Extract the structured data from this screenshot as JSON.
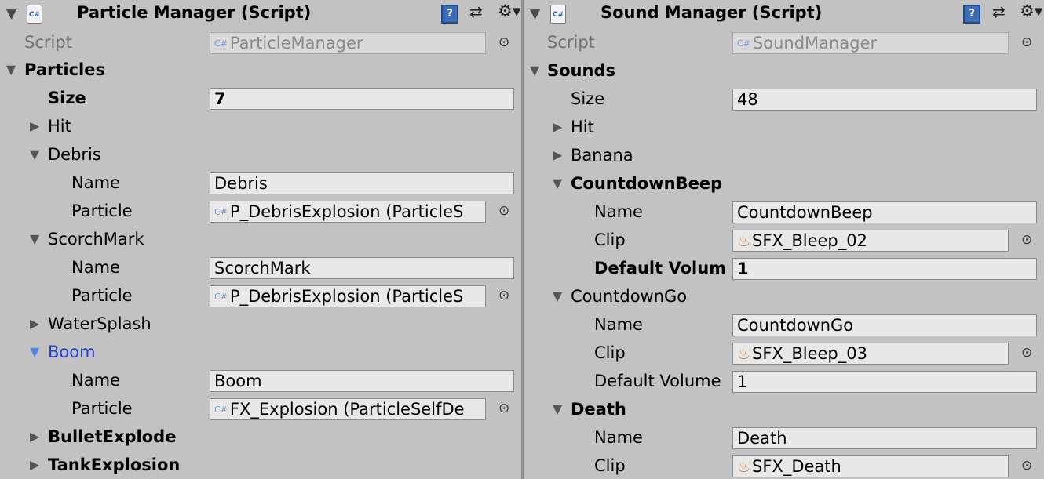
{
  "left": {
    "title": "Particle Manager (Script)",
    "script_label": "Script",
    "script_value": "ParticleManager",
    "list_label": "Particles",
    "size_label": "Size",
    "size_value": "7",
    "items": {
      "hit": "Hit",
      "debris": {
        "label": "Debris",
        "name_label": "Name",
        "name_value": "Debris",
        "particle_label": "Particle",
        "particle_value": "P_DebrisExplosion (ParticleS"
      },
      "scorch": {
        "label": "ScorchMark",
        "name_label": "Name",
        "name_value": "ScorchMark",
        "particle_label": "Particle",
        "particle_value": "P_DebrisExplosion (ParticleS"
      },
      "water": "WaterSplash",
      "boom": {
        "label": "Boom",
        "name_label": "Name",
        "name_value": "Boom",
        "particle_label": "Particle",
        "particle_value": "FX_Explosion (ParticleSelfDe"
      },
      "bullet": "BulletExplode",
      "tank": "TankExplosion"
    }
  },
  "right": {
    "title": "Sound Manager (Script)",
    "script_label": "Script",
    "script_value": "SoundManager",
    "list_label": "Sounds",
    "size_label": "Size",
    "size_value": "48",
    "items": {
      "hit": "Hit",
      "banana": "Banana",
      "beep": {
        "label": "CountdownBeep",
        "name_label": "Name",
        "name_value": "CountdownBeep",
        "clip_label": "Clip",
        "clip_value": "SFX_Bleep_02",
        "vol_label": "Default Volum",
        "vol_value": "1"
      },
      "go": {
        "label": "CountdownGo",
        "name_label": "Name",
        "name_value": "CountdownGo",
        "clip_label": "Clip",
        "clip_value": "SFX_Bleep_03",
        "vol_label": "Default Volume",
        "vol_value": "1"
      },
      "death": {
        "label": "Death",
        "name_label": "Name",
        "name_value": "Death",
        "clip_label": "Clip",
        "clip_value": "SFX_Death"
      }
    }
  },
  "icons": {
    "cs": "C#",
    "help": "?",
    "preset": "⇄",
    "gear": "⚙▾",
    "expanded": "▼",
    "collapsed": "▶",
    "picker": "⊙",
    "audio": "♨"
  }
}
